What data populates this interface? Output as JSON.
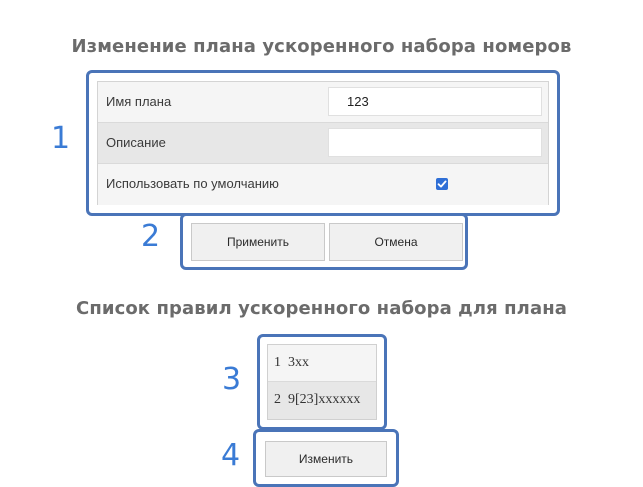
{
  "plan_edit": {
    "title": "Изменение плана ускоренного набора номеров",
    "fields": {
      "name_label": "Имя плана",
      "name_value": "123",
      "description_label": "Описание",
      "description_value": "",
      "default_label": "Использовать по умолчанию",
      "default_checked": true
    },
    "buttons": {
      "apply": "Применить",
      "cancel": "Отмена"
    }
  },
  "rules": {
    "title": "Список правил ускоренного набора для плана",
    "items": [
      {
        "num": "1",
        "pattern": "3xx"
      },
      {
        "num": "2",
        "pattern": "9[23]xxxxxx"
      }
    ],
    "edit_button": "Изменить"
  },
  "markers": [
    "1",
    "2",
    "3",
    "4"
  ],
  "colors": {
    "frame": "#4a74b8",
    "marker": "#3a7bd5",
    "title": "#6b6b6b",
    "checkbox": "#2f6fd6"
  }
}
